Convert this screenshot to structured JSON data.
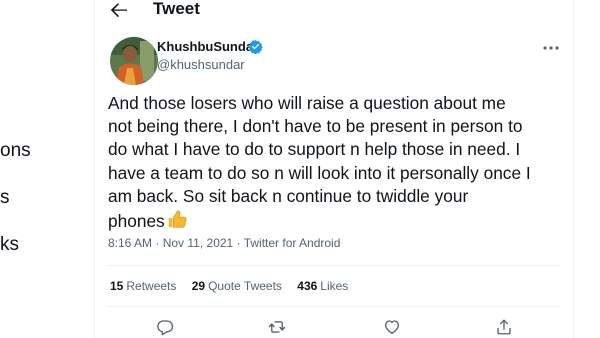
{
  "header": {
    "title": "Tweet"
  },
  "sidebar": {
    "items": [
      {
        "label": "ons"
      },
      {
        "label": "s"
      },
      {
        "label": "ks"
      }
    ]
  },
  "tweet": {
    "author_name": "KhushbuSundar",
    "author_handle": "@khushsundar",
    "text": "And those losers who will raise a question about me\nnot being there, I don't have to be present in person to\ndo what I have to do to support n help those in need. I\nhave a team to do so n will look into it personally once I\nam back. So sit back n continue to twiddle your\nphones",
    "emoji": "thumbs-up",
    "time": "8:16 AM",
    "separator": "·",
    "date": "Nov 11, 2021",
    "source": "Twitter for Android"
  },
  "stats": {
    "retweets_count": "15",
    "retweets_label": "Retweets",
    "quotes_count": "29",
    "quotes_label": "Quote Tweets",
    "likes_count": "436",
    "likes_label": "Likes"
  },
  "actions": [
    "reply-icon",
    "retweet-icon",
    "like-icon",
    "share-icon"
  ],
  "colors": {
    "accent": "#1d9bf0",
    "muted": "#536471",
    "text": "#0f1419",
    "border": "#eff3f4",
    "thumb": "#f4b92e"
  }
}
